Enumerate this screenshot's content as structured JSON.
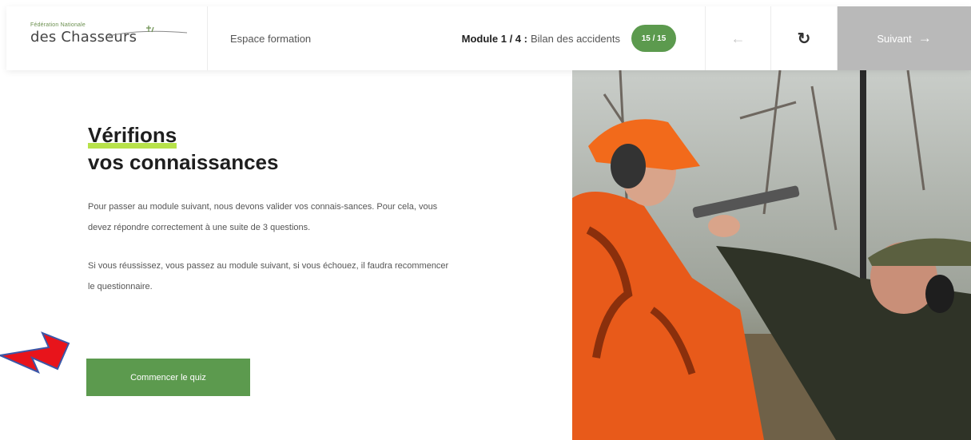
{
  "header": {
    "logo_small": "Fédération Nationale",
    "logo_big": "des Chasseurs",
    "espace": "Espace formation",
    "module_prefix": "Module 1 / 4 :",
    "module_title": "Bilan des accidents",
    "progress_badge": "15 / 15",
    "back_icon": "arrow-left-icon",
    "refresh_icon": "refresh-icon",
    "next_label": "Suivant",
    "next_icon": "arrow-right-icon"
  },
  "content": {
    "title_line1": "Vérifions",
    "title_line2": "vos connaissances",
    "para1": "Pour passer au module suivant, nous devons valider vos connais-sances. Pour cela, vous devez répondre correctement à une suite de 3 questions.",
    "para2": "Si vous réussissez, vous passez au module suivant, si vous échouez, il faudra recommencer le questionnaire.",
    "button_label": "Commencer le quiz"
  },
  "colors": {
    "brand_green": "#5c9a4e",
    "highlight": "#b7e24a",
    "next_disabled": "#b9b9b9",
    "annotation_red": "#e8141b"
  }
}
